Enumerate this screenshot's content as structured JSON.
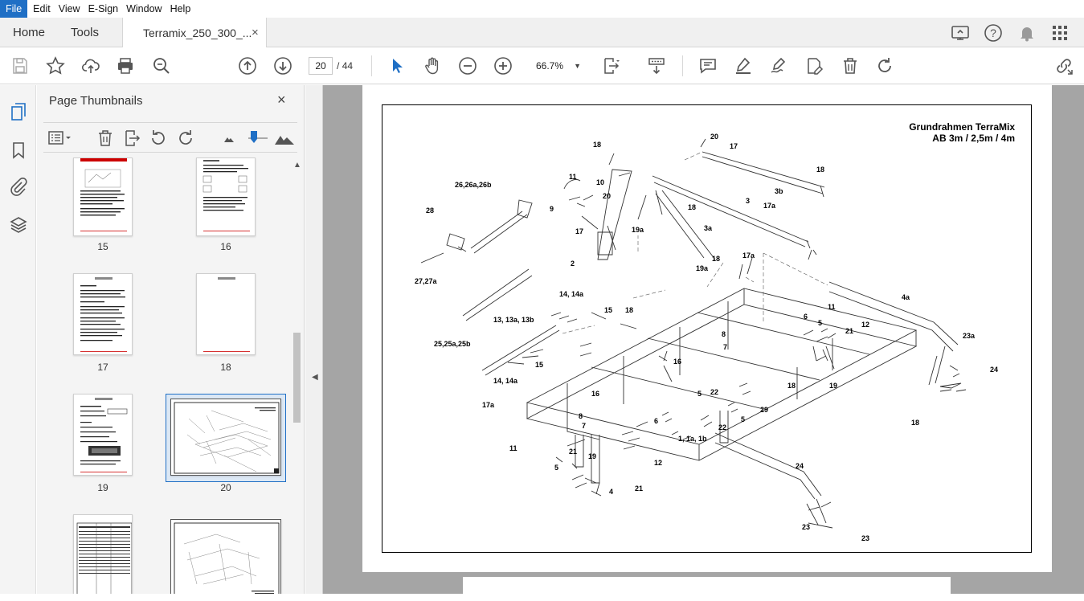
{
  "menu": [
    "File",
    "Edit",
    "View",
    "E-Sign",
    "Window",
    "Help"
  ],
  "tabs": {
    "home": "Home",
    "tools": "Tools",
    "document": "Terramix_250_300_...",
    "close": "×"
  },
  "toolbar": {
    "current_page": "20",
    "page_separator": "/",
    "total_pages": "44",
    "zoom": "66.7%"
  },
  "panel": {
    "title": "Page Thumbnails",
    "close": "×"
  },
  "thumbnails": [
    {
      "label": "15"
    },
    {
      "label": "16"
    },
    {
      "label": "17"
    },
    {
      "label": "18"
    },
    {
      "label": "19"
    },
    {
      "label": "20",
      "selected": true
    },
    {
      "label": ""
    },
    {
      "label": ""
    }
  ],
  "document": {
    "title_line1": "Grundrahmen TerraMix",
    "title_line2": "AB 3m / 2,5m / 4m",
    "callouts": [
      "20",
      "17",
      "18",
      "18",
      "11",
      "10",
      "9",
      "20",
      "17",
      "26,26a,26b",
      "28",
      "3b",
      "17a",
      "18",
      "3",
      "19a",
      "3a",
      "2",
      "19a",
      "18",
      "27,27a",
      "17a",
      "14, 14a",
      "4a",
      "15",
      "18",
      "11",
      "13, 13a, 13b",
      "6",
      "5",
      "21",
      "12",
      "8",
      "7",
      "16",
      "25,25a,25b",
      "15",
      "16",
      "23a",
      "14, 14a",
      "18",
      "19",
      "24",
      "17a",
      "5",
      "22",
      "8",
      "6",
      "7",
      "22",
      "5",
      "29",
      "18",
      "1, 1a, 1b",
      "11",
      "21",
      "19",
      "12",
      "5",
      "21",
      "4",
      "24",
      "23"
    ]
  },
  "colors": {
    "accent": "#1f6fc5",
    "panel_bg": "#f4f4f4",
    "doc_bg": "#a5a5a5",
    "selected_border": "#1f6fc5",
    "icon": "#555555"
  }
}
